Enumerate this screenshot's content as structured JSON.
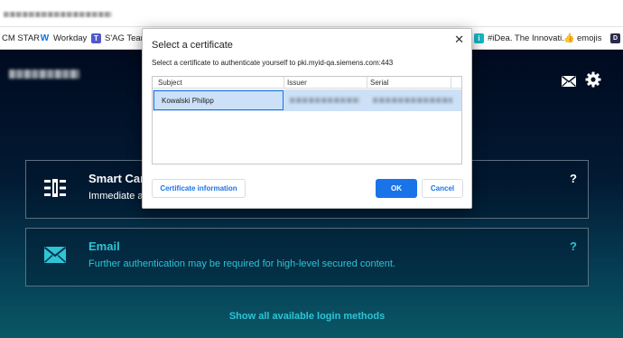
{
  "browser": {
    "bookmarks": [
      {
        "label": "CM STAR",
        "icon": "none"
      },
      {
        "label": "Workday",
        "icon": "workday-icon",
        "color": "#0875e1"
      },
      {
        "label": "S'AG Teams",
        "icon": "teams-icon",
        "color": "#5059c9"
      },
      {
        "label": "#iDea. The Innovati...",
        "icon": "idea-icon",
        "color": "#14b8c8"
      },
      {
        "label": "emojis",
        "icon": "thumbs-up-icon",
        "color": "#c68642"
      }
    ]
  },
  "dialog": {
    "title": "Select a certificate",
    "close": "✕",
    "subtitle": "Select a certificate to authenticate yourself to pki.myid-qa.siemens.com:443",
    "columns": [
      "Subject",
      "Issuer",
      "Serial"
    ],
    "rows": [
      {
        "subject": "Kowalski Philipp"
      }
    ],
    "buttons": {
      "info": "Certificate information",
      "ok": "OK",
      "cancel": "Cancel"
    }
  },
  "page": {
    "cards": [
      {
        "title": "Smart Card",
        "description": "Immediate access",
        "help": "?",
        "icon": "smart-card-chip-icon"
      },
      {
        "title": "Email",
        "description": "Further authentication may be required for high-level secured content.",
        "help": "?",
        "icon": "envelope-icon"
      }
    ],
    "show_all": "Show all available login methods",
    "colors": {
      "accent": "#2ec4d6",
      "primary_button": "#1a73e8"
    }
  }
}
